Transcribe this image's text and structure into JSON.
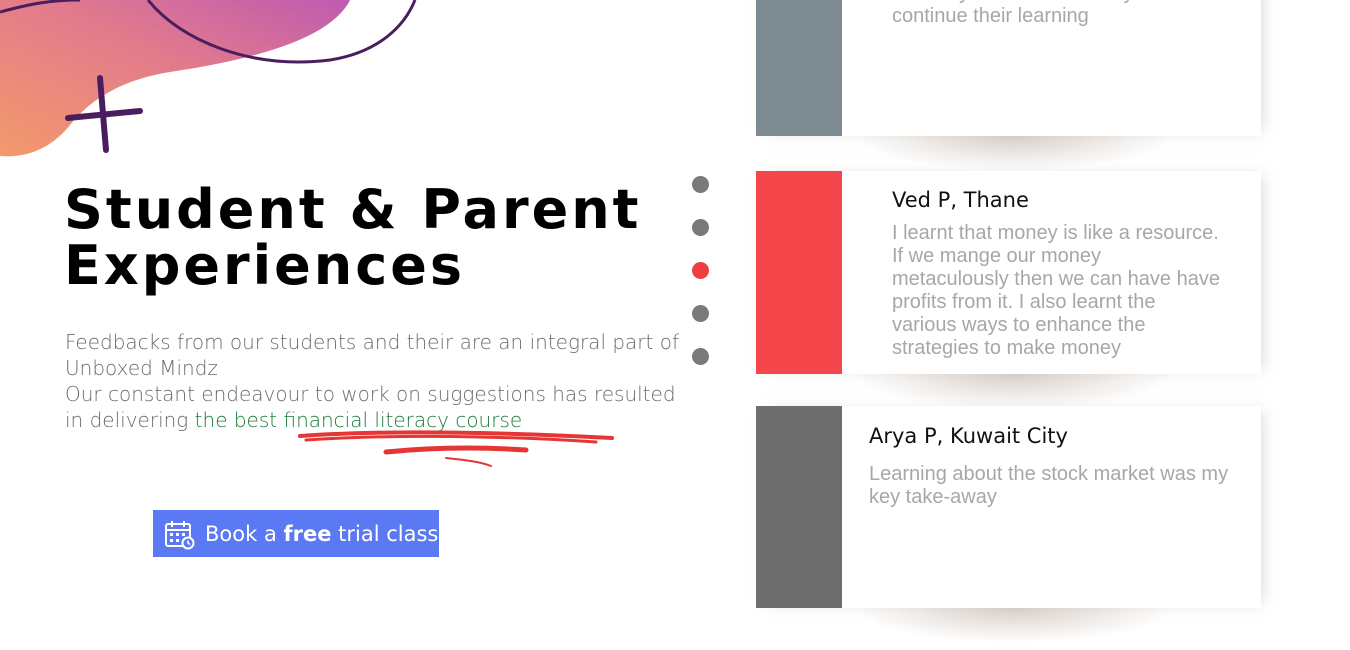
{
  "heading": {
    "line1": "Student & Parent",
    "line2": "Experiences"
  },
  "description": {
    "line1": "Feedbacks from our students and their are an integral part of Unboxed Mindz",
    "line2_prefix": "Our constant endeavour to work on suggestions has resulted in delivering ",
    "line2_highlight": "the best financial literacy course"
  },
  "cta": {
    "prefix": "Book a ",
    "bold": "free",
    "suffix": " trial class",
    "icon": "calendar-icon"
  },
  "carousel": {
    "dot_count": 5,
    "active_index": 2
  },
  "testimonials": [
    {
      "name": "",
      "text": "You may share with us  ways to continue their learning",
      "bar_color": "#7e8a91"
    },
    {
      "name": "Ved P, Thane",
      "text": "I learnt that money is like a resource. If we mange our money metaculously then we can have have profits from it. I also learnt the various ways to enhance the strategies to make money",
      "bar_color": "#f5474b"
    },
    {
      "name": "Arya P, Kuwait City",
      "text": "Learning about the stock market was my key take-away",
      "bar_color": "#6e6e6e"
    }
  ],
  "colors": {
    "accent_blue": "#5b79f2",
    "highlight_green": "#1b7a3a",
    "dot_active": "#ef3e42",
    "dot_inactive": "#7a7a7a",
    "scribble_red": "#e63535",
    "decor_purple": "#4a1e5e"
  }
}
